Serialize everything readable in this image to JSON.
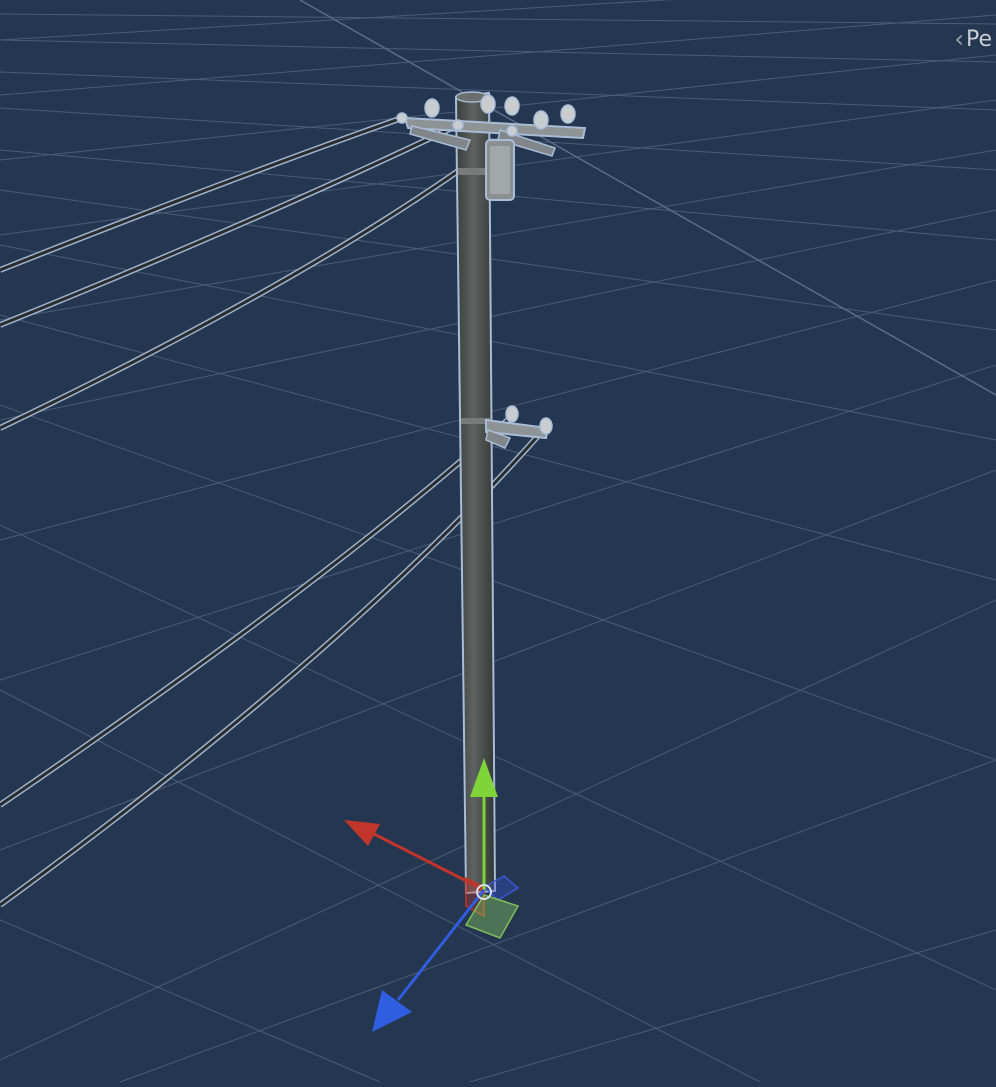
{
  "scene_view": {
    "projection_label": "Persp",
    "projection_label_visible": "Pe",
    "chevron_icon": "chevron-left-icon"
  },
  "gizmo": {
    "axes": [
      {
        "axis": "x",
        "color": "#c1352b",
        "icon": "x-axis-arrow-icon"
      },
      {
        "axis": "y",
        "color": "#7fd43a",
        "icon": "y-axis-arrow-icon"
      },
      {
        "axis": "z",
        "color": "#2f5ee0",
        "icon": "z-axis-arrow-icon"
      }
    ],
    "plane_handles": [
      {
        "plane": "xz",
        "color": "#7fbf5a"
      },
      {
        "plane": "xy",
        "color": "#3a57d6"
      },
      {
        "plane": "yz",
        "color": "#c1352b"
      }
    ]
  },
  "colors": {
    "background": "#243650",
    "grid_line": "#4a5c78",
    "pole": "#4e5250",
    "wire": "#2a2c2e",
    "selection_outline": "#a8bcd6"
  }
}
